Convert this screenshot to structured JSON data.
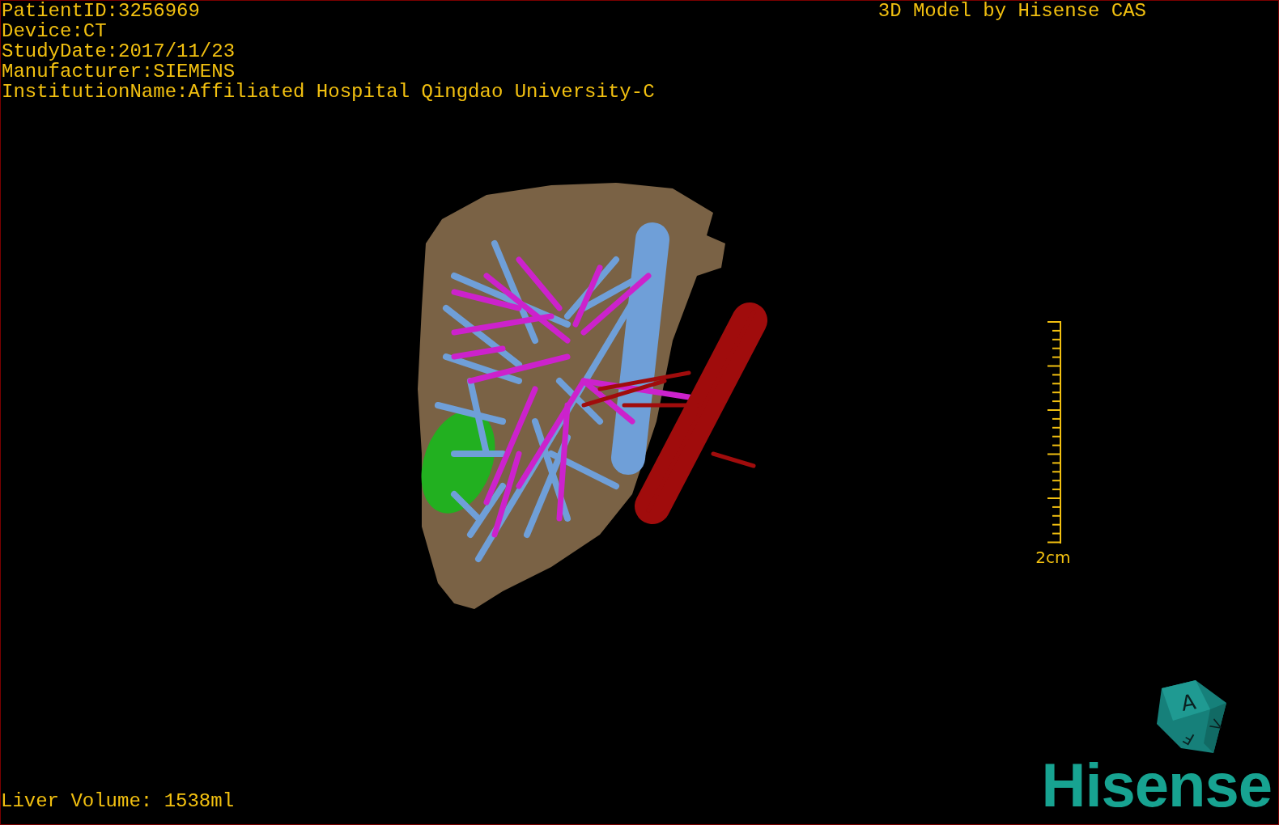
{
  "info": [
    "PatientID:3256969",
    "Device:CT",
    "StudyDate:2017/11/23",
    "Manufacturer:SIEMENS",
    "InstitutionName:Affiliated Hospital Qingdao University-C"
  ],
  "title": "3D Model by Hisense CAS",
  "scale_bar": {
    "label": "2cm"
  },
  "orientation_cube": {
    "labels": [
      "A",
      "F",
      "V"
    ]
  },
  "liver_volume": "Liver Volume: 1538ml",
  "logo": "Hisense"
}
